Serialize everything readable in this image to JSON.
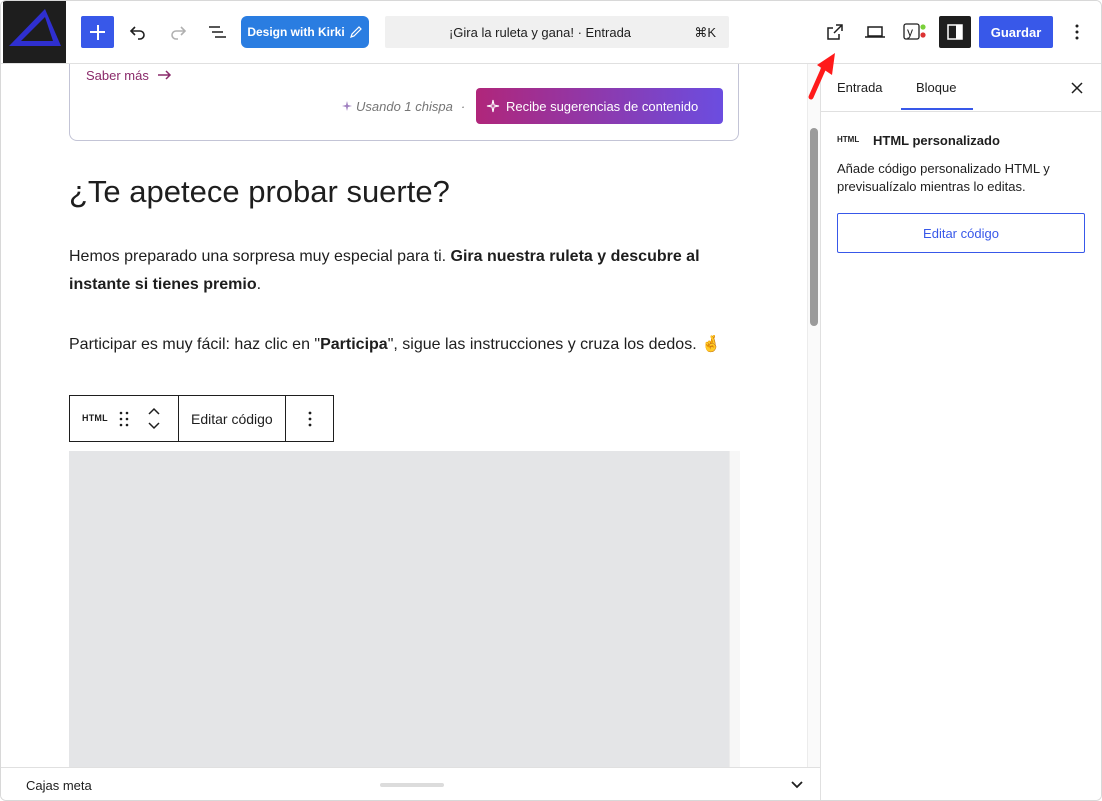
{
  "toolbar": {
    "kirki_label": "Design with Kirki",
    "document_title": "¡Gira la ruleta y gana! · Entrada",
    "shortcut": "⌘K",
    "save_label": "Guardar"
  },
  "editor": {
    "learn_more": "Saber más",
    "spark_usage": "Usando 1 chispa",
    "suggest_label": "Recibe sugerencias de contenido",
    "heading": "¿Te apetece probar suerte?",
    "para1_a": "Hemos preparado una sorpresa muy especial para ti. ",
    "para1_b": "Gira nuestra ruleta y descubre al instante si tienes premio",
    "para1_c": ".",
    "para2_a": "Participar es muy fácil: haz clic en \"",
    "para2_b": "Participa",
    "para2_c": "\", sigue las instrucciones y cruza los dedos. 🤞",
    "block_type_label": "HTML",
    "block_edit_label": "Editar código"
  },
  "meta": {
    "label": "Cajas meta"
  },
  "sidebar": {
    "tabs": [
      "Entrada",
      "Bloque"
    ],
    "active_tab": "Bloque",
    "block_icon": "HTML",
    "block_title": "HTML personalizado",
    "block_description": "Añade código personalizado HTML y previsualízalo mientras lo editas.",
    "edit_code_label": "Editar código"
  },
  "colors": {
    "accent": "#3858e9",
    "kirki": "#2a7de1",
    "annotation_arrow": "#ff0000"
  },
  "icons": [
    "plus-icon",
    "undo-icon",
    "redo-icon",
    "list-view-icon",
    "pencil-icon",
    "external-link-icon",
    "laptop-preview-icon",
    "yoast-icon",
    "sidebar-toggle-icon",
    "more-vertical-icon",
    "sparkle-icon",
    "arrow-right-icon",
    "drag-handle-icon",
    "chevron-up-icon",
    "chevron-down-icon",
    "close-icon"
  ]
}
